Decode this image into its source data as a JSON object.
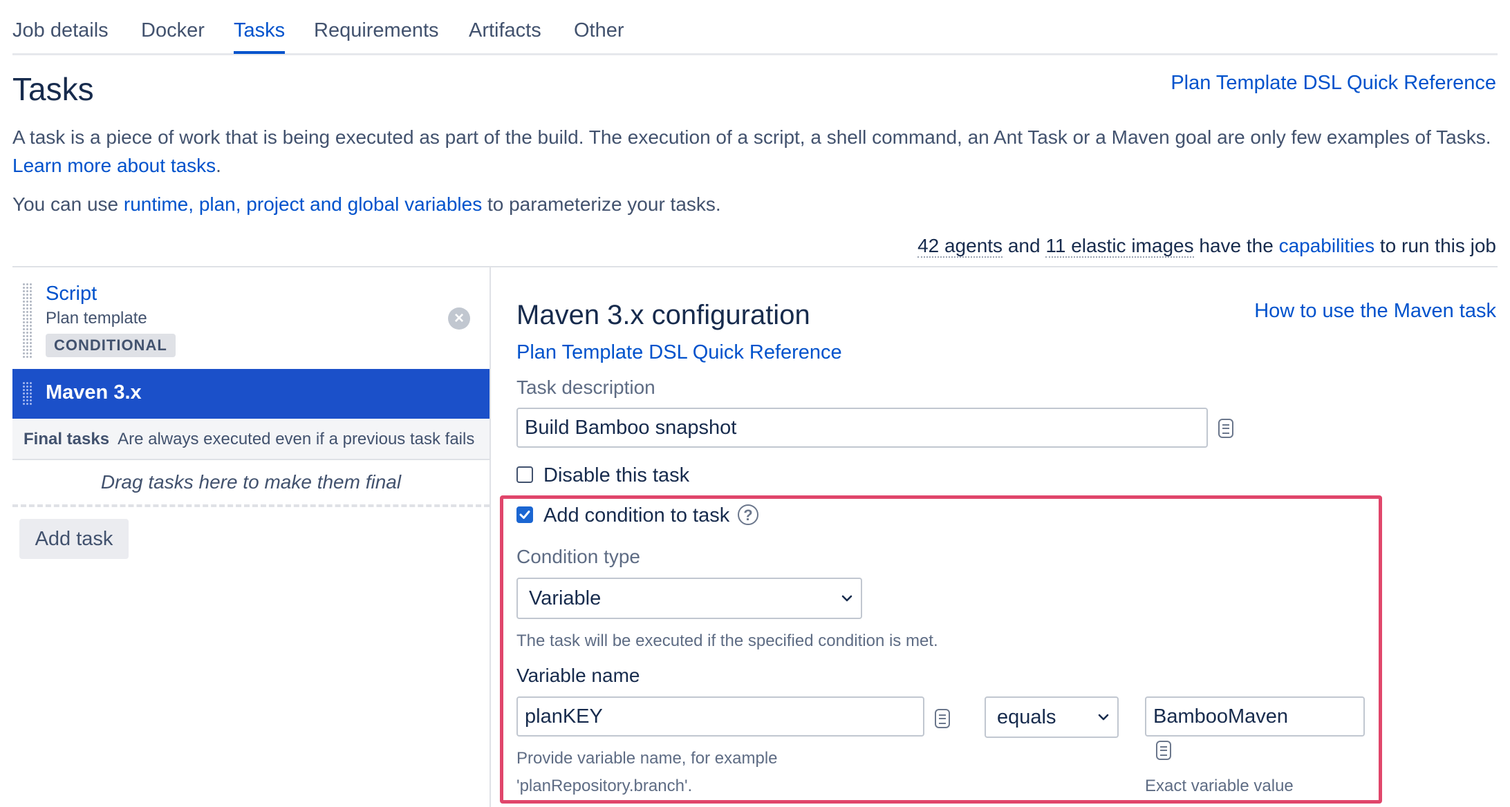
{
  "tabs": [
    {
      "label": "Job details"
    },
    {
      "label": "Docker"
    },
    {
      "label": "Tasks"
    },
    {
      "label": "Requirements"
    },
    {
      "label": "Artifacts"
    },
    {
      "label": "Other"
    }
  ],
  "active_tab": "Tasks",
  "page": {
    "title": "Tasks",
    "dsl_link": "Plan Template DSL Quick Reference",
    "intro_text": "A task is a piece of work that is being executed as part of the build. The execution of a script, a shell command, an Ant Task or a Maven goal are only few examples of Tasks.",
    "learn_more_link": "Learn more about tasks",
    "intro_end": ".",
    "vars_prefix": "You can use ",
    "vars_link": "runtime, plan, project and global variables",
    "vars_suffix": " to parameterize your tasks.",
    "agents_count": "42 agents",
    "and_text": " and ",
    "images_count": "11 elastic images",
    "have_the": " have the ",
    "capabilities_link": "capabilities",
    "run_job": " to run this job"
  },
  "task_list": {
    "script": {
      "title": "Script",
      "subtitle": "Plan template",
      "badge": "CONDITIONAL",
      "remove_glyph": "×"
    },
    "maven": {
      "title": "Maven 3.x"
    },
    "final_tasks_label": "Final tasks",
    "final_tasks_desc": "Are always executed even if a previous task fails",
    "drag_text": "Drag tasks here to make them final",
    "add_task": "Add task"
  },
  "config": {
    "title": "Maven 3.x configuration",
    "help_link": "How to use the Maven task",
    "dsl_link": "Plan Template DSL Quick Reference",
    "task_description_label": "Task description",
    "task_description_value": "Build Bamboo snapshot",
    "disable_label": "Disable this task",
    "disable_checked": false,
    "add_condition_label": "Add condition to task",
    "add_condition_checked": true,
    "help_glyph": "?",
    "condition_type_label": "Condition type",
    "condition_type_value": "Variable",
    "condition_desc": "The task will be executed if the specified condition is met.",
    "variable_name_label": "Variable name",
    "variable_name_value": "planKEY",
    "variable_name_help_1": "Provide variable name, for example",
    "variable_name_help_2": "'planRepository.branch'.",
    "operator_value": "equals",
    "variable_value": "BambooMaven",
    "variable_value_help": "Exact variable value"
  },
  "colors": {
    "link": "#0052cc",
    "selected_task_bg": "#1b50c9",
    "highlight_border": "#e0466b",
    "checkbox_checked": "#1b66d2"
  }
}
